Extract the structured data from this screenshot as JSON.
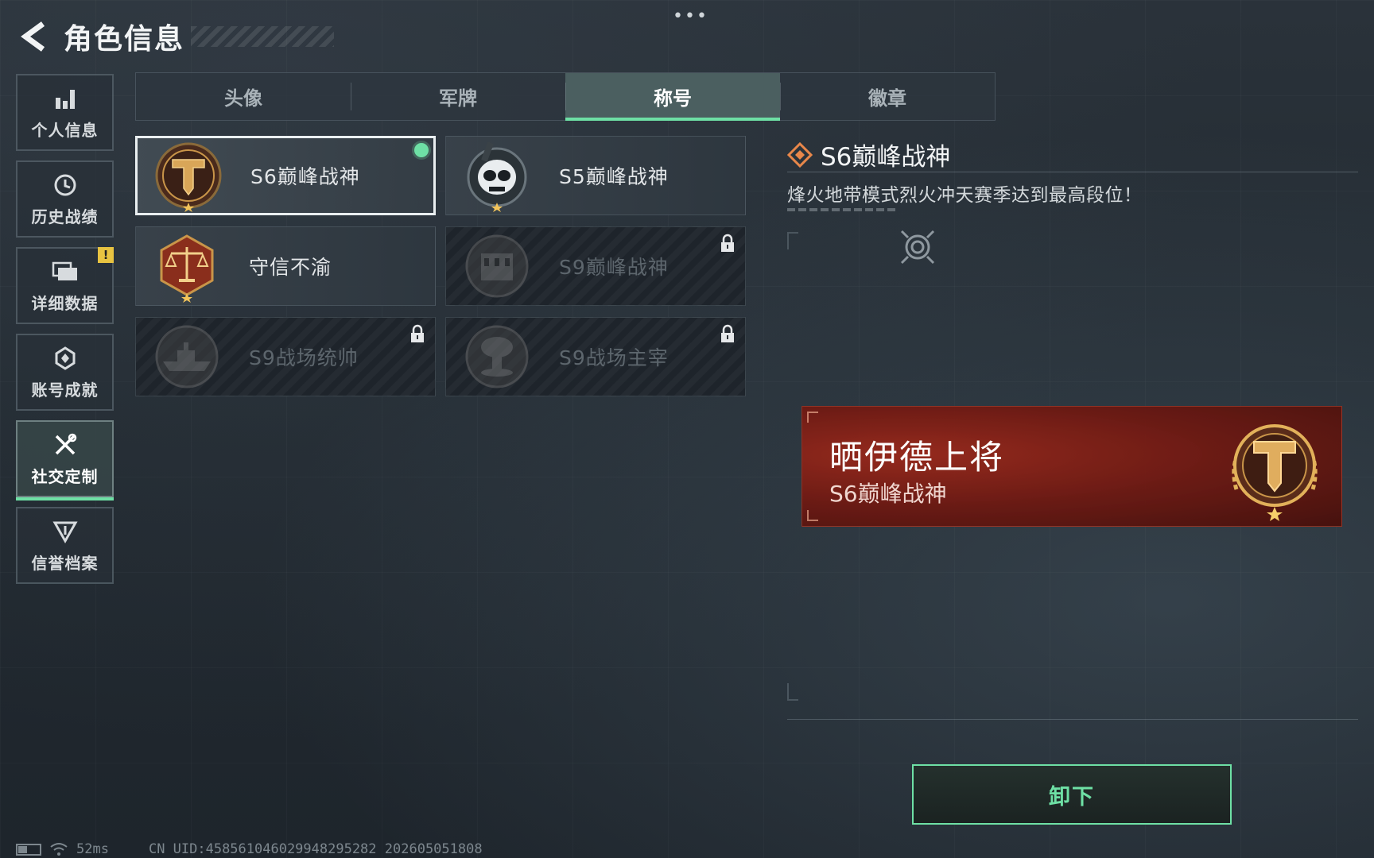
{
  "header": {
    "title": "角色信息",
    "more_icon": "more-dots-icon"
  },
  "sidebar": {
    "items": [
      {
        "label": "个人信息",
        "icon": "bar-chart-icon"
      },
      {
        "label": "历史战绩",
        "icon": "history-clock-icon"
      },
      {
        "label": "详细数据",
        "icon": "folders-icon",
        "badge": "!"
      },
      {
        "label": "账号成就",
        "icon": "achievement-icon"
      },
      {
        "label": "社交定制",
        "icon": "tools-icon",
        "active": true
      },
      {
        "label": "信誉档案",
        "icon": "reputation-icon"
      }
    ]
  },
  "tabs": [
    {
      "label": "头像"
    },
    {
      "label": "军牌"
    },
    {
      "label": "称号",
      "active": true
    },
    {
      "label": "徽章"
    }
  ],
  "cards": [
    {
      "label": "S6巅峰战神",
      "emblem": "gold-t-emblem",
      "state": "selected-equipped"
    },
    {
      "label": "S5巅峰战神",
      "emblem": "skull-emblem",
      "state": "unlocked"
    },
    {
      "label": "守信不渝",
      "emblem": "scales-emblem",
      "state": "unlocked"
    },
    {
      "label": "S9巅峰战神",
      "emblem": "building-emblem",
      "state": "locked"
    },
    {
      "label": "S9战场统帅",
      "emblem": "warship-emblem",
      "state": "locked"
    },
    {
      "label": "S9战场主宰",
      "emblem": "mushroom-cloud-emblem",
      "state": "locked"
    }
  ],
  "detail": {
    "title": "S6巅峰战神",
    "description": "烽火地带模式烈火冲天赛季达到最高段位！",
    "title_icon": "diamond-marker-icon"
  },
  "namecard": {
    "player_name": "晒伊德上将",
    "title": "S6巅峰战神",
    "emblem": "gold-t-emblem"
  },
  "actions": {
    "unequip_label": "卸下"
  },
  "status": {
    "ping": "52ms",
    "uid": "CN UID:458561046029948295282 202605051808"
  },
  "colors": {
    "accent_green": "#6ee0a5",
    "namecard_red": "#8a1e14",
    "badge_yellow": "#e8c341",
    "gold": "#c99549"
  }
}
